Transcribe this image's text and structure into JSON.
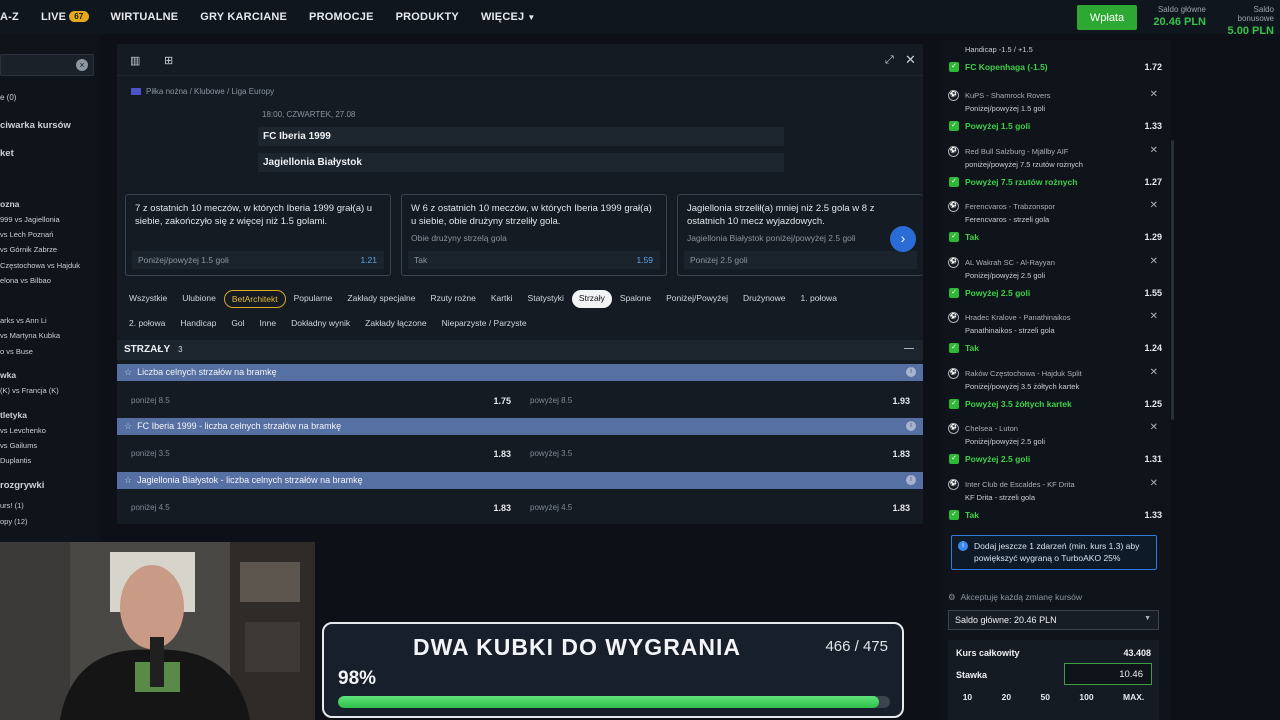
{
  "nav": {
    "items": [
      "A-Z",
      "LIVE",
      "WIRTUALNE",
      "GRY KARCIANE",
      "PROMOCJE",
      "PRODUKTY",
      "WIĘCEJ"
    ],
    "live_count": "67",
    "deposit": "Wpłata",
    "main_balance_label": "Saldo główne",
    "main_balance": "20.46 PLN",
    "bonus_balance_label": "Saldo bonusowe",
    "bonus_balance": "5.00 PLN"
  },
  "sidebar": {
    "rows": [
      "e (0)",
      "ciwarka kursów",
      "ket",
      "ozna",
      "999 vs Jagiellonia",
      "vs Lech Poznań",
      "vs Górnik Zabrze",
      "Częstochowa vs Hajduk",
      "elona vs Bilbao",
      "arks vs Ann Li",
      "vs Martyna Kubka",
      "o vs Buse",
      "wka",
      "(K) vs Francja (K)",
      "tletyka",
      "vs Levchenko",
      "vs Gailums",
      "Duplantis",
      "rozgrywki",
      "urs! (1)",
      "opy (12)"
    ]
  },
  "event": {
    "breadcrumb": "Piłka nożna / Klubowe / Liga Europy",
    "time": "18:00, CZWARTEK, 27.08",
    "home": "FC Iberia 1999",
    "away": "Jagiellonia Białystok"
  },
  "stats_cards": [
    {
      "text": "7 z ostatnich 10 meczów, w których Iberia 1999 grał(a) u siebie, zakończyło się z więcej niż 1.5 golami.",
      "sub": "",
      "pick": "Poniżej/powyżej 1.5 goli",
      "odd": "1.21"
    },
    {
      "text": "W 6 z ostatnich 10 meczów, w których Iberia 1999 grał(a) u siebie, obie drużyny strzeliły gola.",
      "sub": "Obie drużyny strzelą gola",
      "pick": "Tak",
      "odd": "1.59"
    },
    {
      "text": "Jagiellonia strzelił(a) mniej niż 2.5 gola w 8 z ostatnich 10 mecz wyjazdowych.",
      "sub": "Jagiellonia Białystok poniżej/powyżej 2.5 goli",
      "pick": "Poniżej 2.5 goli",
      "odd": ""
    }
  ],
  "tabs_row1": [
    "Wszystkie",
    "Ulubione",
    "BetArchitekt",
    "Popularne",
    "Zakłady specjalne",
    "Rzuty rożne",
    "Kartki",
    "Statystyki",
    "Strzały",
    "Spalone",
    "Poniżej/Powyżej",
    "Drużynowe",
    "1. połowa"
  ],
  "tabs_row2": [
    "2. połowa",
    "Handicap",
    "Gol",
    "Inne",
    "Dokładny wynik",
    "Zakłady łączone",
    "Nieparzyste / Parzyste"
  ],
  "section": {
    "title": "STRZAŁY",
    "count": "3"
  },
  "markets": [
    {
      "name": "Liczba celnych strzałów na bramkę",
      "under": "poniżej 8.5",
      "under_odd": "1.75",
      "over": "powyżej 8.5",
      "over_odd": "1.93"
    },
    {
      "name": "FC Iberia 1999 - liczba celnych strzałów na bramkę",
      "under": "poniżej 3.5",
      "under_odd": "1.83",
      "over": "powyżej 3.5",
      "over_odd": "1.83"
    },
    {
      "name": "Jagiellonia Białystok - liczba celnych strzałów na bramkę",
      "under": "poniżej 4.5",
      "under_odd": "1.83",
      "over": "powyżej 4.5",
      "over_odd": "1.83"
    }
  ],
  "slip": {
    "top_market": "Handicap -1.5 / +1.5",
    "top_pick": "FC Kopenhaga (-1.5)",
    "top_odd": "1.72",
    "legs": [
      {
        "event": "KuPS - Shamrock Rovers",
        "market": "Poniżej/powyżej 1.5 goli",
        "pick": "Powyżej 1.5 goli",
        "odd": "1.33"
      },
      {
        "event": "Red Bull Salzburg - Mjällby AIF",
        "market": "poniżej/powyżej 7.5 rzutów rożnych",
        "pick": "Powyżej 7.5 rzutów rożnych",
        "odd": "1.27"
      },
      {
        "event": "Ferencvaros - Trabzonspor",
        "market": "Ferencvaros - strzeli gola",
        "pick": "Tak",
        "odd": "1.29"
      },
      {
        "event": "AL Wakrah SC - Al-Rayyan",
        "market": "Poniżej/powyżej 2.5 goli",
        "pick": "Powyżej 2.5 goli",
        "odd": "1.55"
      },
      {
        "event": "Hradec Kralove - Panathinaikos",
        "market": "Panathinaikos - strzeli gola",
        "pick": "Tak",
        "odd": "1.24"
      },
      {
        "event": "Raków Częstochowa - Hajduk Split",
        "market": "Poniżej/powyżej 3.5 żółtych kartek",
        "pick": "Powyżej 3.5 żółtych kartek",
        "odd": "1.25"
      },
      {
        "event": "Chelsea - Luton",
        "market": "Poniżej/powyżej 2.5 goli",
        "pick": "Powyżej 2.5 goli",
        "odd": "1.31"
      },
      {
        "event": "Inter Club de Escaldes - KF Drita",
        "market": "KF Drita - strzeli gola",
        "pick": "Tak",
        "odd": "1.33"
      }
    ],
    "info": "Dodaj jeszcze 1 zdarzeń (min. kurs 1.3) aby powiększyć wygraną o TurboAKO 25%",
    "accept": "Akceptuję każdą zmianę kursów",
    "account": "Saldo główne: 20.46 PLN",
    "total_label": "Kurs całkowity",
    "total": "43.408",
    "stake_label": "Stawka",
    "stake": "10.46",
    "chips": [
      "10",
      "20",
      "50",
      "100",
      "MAX."
    ]
  },
  "overlay": {
    "title": "DWA KUBKI DO WYGRANIA",
    "count": "466 / 475",
    "percent": "98%",
    "progress": 0.98
  }
}
